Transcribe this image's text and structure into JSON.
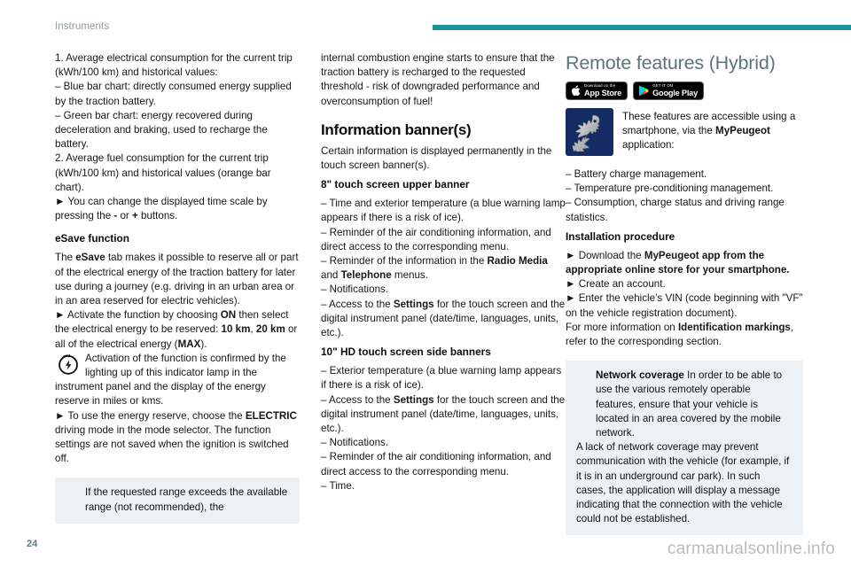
{
  "header": {
    "section_label": "Instruments",
    "rule_color": "#1a9398"
  },
  "footer": {
    "page_number": "24",
    "watermark": "carmanualsonline.info"
  },
  "column_left": {
    "item1": "1.  Average electrical consumption for the current trip (kWh/100 km) and historical values:",
    "dash1": "–  Blue bar chart: directly consumed energy supplied by the traction battery.",
    "dash2": "–  Green bar chart: energy recovered during deceleration and braking, used to recharge the battery.",
    "item2": "2.  Average fuel consumption for the current trip (kWh/100 km) and historical values (orange bar chart).",
    "bullet_timescale_pre": "►  You can change the displayed time scale by pressing the ",
    "bullet_timescale_minus": "-",
    "bullet_timescale_mid": " or ",
    "bullet_timescale_plus": "+",
    "bullet_timescale_post": " buttons.",
    "esave_heading": "eSave function",
    "esave_p1_pre": "The ",
    "esave_p1_bold": "eSave",
    "esave_p1_post": " tab makes it possible to reserve all or part of the electrical energy of the traction battery for later use during a journey (e.g. driving in an urban area or in an area reserved for electric vehicles).",
    "esave_activate_pre": "►  Activate the function by choosing ",
    "esave_activate_on": "ON",
    "esave_activate_mid": " then select the electrical energy to be reserved: ",
    "esave_activate_10": "10 km",
    "esave_activate_comma": ", ",
    "esave_activate_20": "20 km",
    "esave_activate_or": " or all of the electrical energy (",
    "esave_activate_max": "MAX",
    "esave_activate_end": ").",
    "esave_lamp": "Activation of the function is confirmed by the lighting up of this indicator lamp in the instrument panel and the display of the energy reserve in miles or kms.",
    "esave_reserve_pre": "►  To use the energy reserve, choose the ",
    "esave_reserve_bold": "ELECTRIC",
    "esave_reserve_post": " driving mode in the mode selector. The function settings are not saved when the ignition is switched off.",
    "warning_text": "If the requested range exceeds the available range (not recommended), the"
  },
  "column_middle": {
    "warning_continued": "internal combustion engine starts to ensure that the traction battery is recharged to the requested threshold - risk of downgraded performance and overconsumption of fuel!",
    "title": "Information banner(s)",
    "intro": "Certain information is displayed permanently in the touch screen banner(s).",
    "sub1": "8\" touch screen upper banner",
    "b1_1": "–  Time and exterior temperature (a blue warning lamp appears if there is a risk of ice).",
    "b1_2": "–  Reminder of the air conditioning information, and direct access to the corresponding menu.",
    "b1_3_pre": "–  Reminder of the information in the ",
    "b1_3_bold1": "Radio Media",
    "b1_3_mid": " and ",
    "b1_3_bold2": "Telephone",
    "b1_3_post": " menus.",
    "b1_4": "–  Notifications.",
    "b1_5_pre": "–  Access to the ",
    "b1_5_bold": "Settings",
    "b1_5_post": " for the touch screen and the digital instrument panel (date/time, languages, units, etc.).",
    "sub2": "10\" HD touch screen side banners",
    "b2_1": "–  Exterior temperature (a blue warning lamp appears if there is a risk of ice).",
    "b2_2_pre": "–  Access to the ",
    "b2_2_bold": "Settings",
    "b2_2_post": " for the touch screen and the digital instrument panel (date/time, languages, units, etc.).",
    "b2_3": "–  Notifications.",
    "b2_4": "–  Reminder of the air conditioning information, and direct access to the corresponding menu.",
    "b2_5": "–  Time."
  },
  "column_right": {
    "title": "Remote features (Hybrid)",
    "badges": [
      {
        "id": "app-store",
        "small": "Download on the",
        "big": "App Store"
      },
      {
        "id": "google-play",
        "small": "GET IT ON",
        "big": "Google Play"
      }
    ],
    "logo_alt": "peugeot-lion-logo",
    "logo_bg": "#152b63",
    "intro_pre": "These features are accessible using a smartphone, via the ",
    "intro_bold": "MyPeugeot",
    "intro_post": " application:",
    "feat1": "–  Battery charge management.",
    "feat2": "–  Temperature pre-conditioning management.",
    "feat3": "–  Consumption, charge status and driving range statistics.",
    "install_heading": "Installation procedure",
    "install_1_pre": "►  Download the ",
    "install_1_bold": "MyPeugeot app from the appropriate online store for your smartphone.",
    "install_2": "►  Create an account.",
    "install_3": "►  Enter the vehicle’s VIN (code beginning with \"VF\" on the vehicle registration document).",
    "install_4_pre": "For more information on ",
    "install_4_bold": "Identification markings",
    "install_4_post": ", refer to the corresponding section.",
    "info_title": "Network coverage",
    "info_p1": "In order to be able to use the various remotely operable features, ensure that your vehicle is located in an area covered by the mobile network.",
    "info_p2": "A lack of network coverage may prevent communication with the vehicle (for example, if it is in an underground car park). In such cases, the application will display a message indicating that the connection with the vehicle could not be established."
  }
}
